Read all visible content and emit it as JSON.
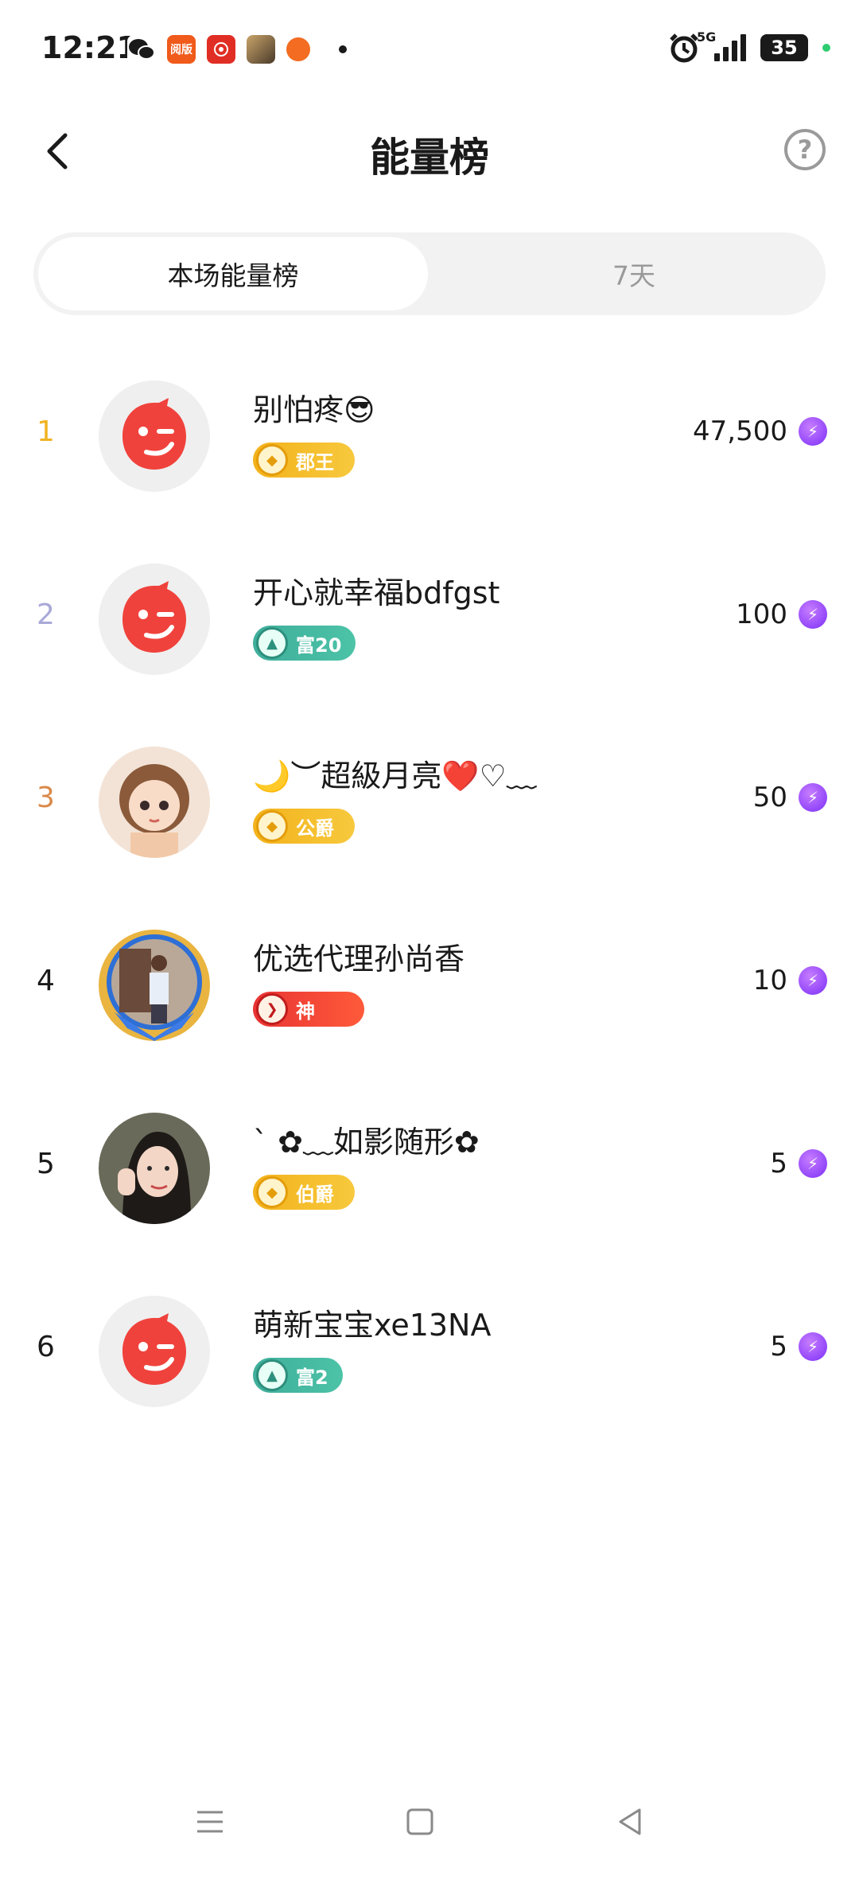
{
  "status_bar": {
    "time": "12:21",
    "network": "5G",
    "battery": "35",
    "apps": [
      {
        "icon": "wechat-icon",
        "color": "#ffffff"
      },
      {
        "icon": "reader-app-icon",
        "color": "#f05a1a",
        "label": "阅版"
      },
      {
        "icon": "pinduoduo-icon",
        "color": "#e02e24"
      },
      {
        "icon": "game-app-icon",
        "color": "#7a6a4a"
      },
      {
        "icon": "orange-app-icon",
        "color": "#f36c21"
      }
    ]
  },
  "header": {
    "title": "能量榜",
    "help_label": "?"
  },
  "tabs": [
    {
      "label": "本场能量榜",
      "active": true
    },
    {
      "label": "7天",
      "active": false
    }
  ],
  "ranking": [
    {
      "rank": "1",
      "rank_color": "#f0b323",
      "name": "别怕疼😎",
      "badge": "郡王",
      "badge_style": "gold",
      "score": "47,500",
      "avatar": "default"
    },
    {
      "rank": "2",
      "rank_color": "#a9a9d8",
      "name": "开心就幸福bdfgst",
      "badge": "富20",
      "badge_style": "teal",
      "score": "100",
      "avatar": "default"
    },
    {
      "rank": "3",
      "rank_color": "#d98a4a",
      "name": "🌙︶超級月亮❤️♡﹏",
      "badge": "公爵",
      "badge_style": "gold",
      "score": "50",
      "avatar": "photo-girl"
    },
    {
      "rank": "4",
      "rank_color": "#1a1a1a",
      "name": "优选代理孙尚香",
      "badge": "神",
      "badge_style": "red",
      "score": "10",
      "avatar": "photo-man"
    },
    {
      "rank": "5",
      "rank_color": "#1a1a1a",
      "name": "ˋ ✿﹏如影随形✿",
      "badge": "伯爵",
      "badge_style": "gold",
      "score": "5",
      "avatar": "photo-woman"
    },
    {
      "rank": "6",
      "rank_color": "#1a1a1a",
      "name": "萌新宝宝xe13NA",
      "badge": "富2",
      "badge_style": "teal",
      "score": "5",
      "avatar": "default"
    }
  ],
  "colors": {
    "default_avatar": "#f0423c",
    "energy_icon": "#8a3ff5"
  }
}
